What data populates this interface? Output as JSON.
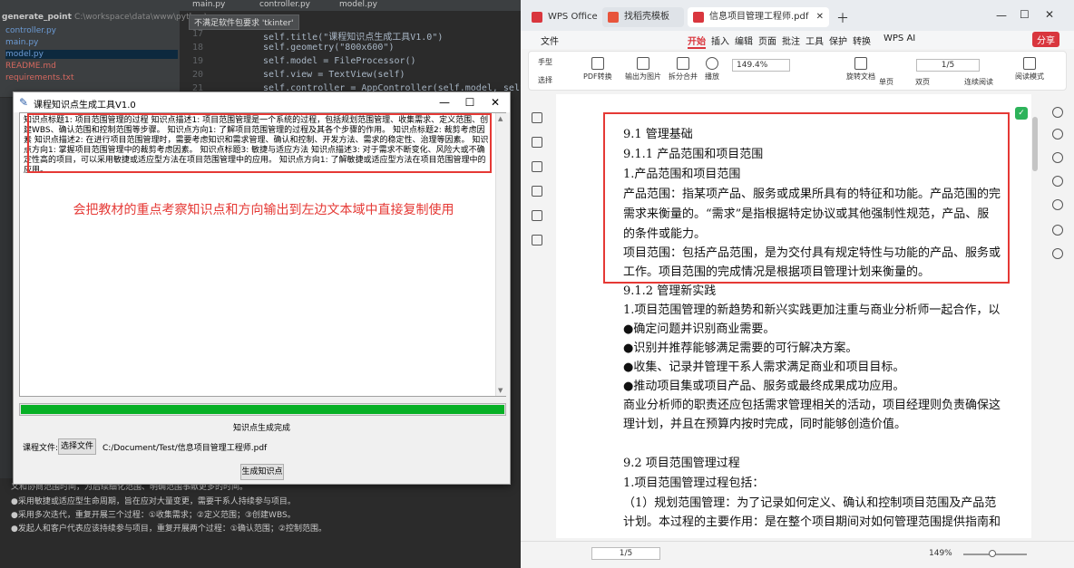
{
  "ide": {
    "tabs": [
      "main.py",
      "controller.py",
      "model.py"
    ],
    "project_root": "generate_point",
    "project_path": "C:\\workspace\\data\\www\\python\\e",
    "files": [
      "controller.py",
      "main.py",
      "model.py",
      "README.md",
      "requirements.txt"
    ],
    "tooltip": "不满足软件包要求 'tkinter'",
    "line_numbers": [
      "17",
      "18",
      "19",
      "20",
      "21"
    ],
    "code_lines": [
      "self.title(\"课程知识点生成工具V1.0\")",
      "self.geometry(\"800x600\")",
      "self.model = FileProcessor()",
      "self.view = TextView(self)",
      "self.controller = AppController(self.model, self.vie"
    ],
    "bottom_lines": [
      "义和协商范围时间，为后续细化范围、明确范围事献更多的时间。",
      "●采用敏捷或适应型生命周期，旨在应对大量变更，需要干系人持续参与项目。",
      "●采用多次迭代，重复开展三个过程：①收集需求；②定义范围；③创建WBS。",
      "●发起人和客户代表应该持续参与项目，重复开展两个过程：①确认范围；②控制范围。"
    ]
  },
  "tk": {
    "title": "课程知识点生成工具V1.0",
    "text_content": "知识点标题1: 项目范围管理的过程 知识点描述1: 项目范围管理是一个系统的过程，包括规划范围管理、收集需求、定义范围、创建WBS、确认范围和控制范围等步骤。 知识点方向1: 了解项目范围管理的过程及其各个步骤的作用。 知识点标题2: 裁剪考虑因素 知识点描述2: 在进行项目范围管理时，需要考虑知识和需求管理、确认和控制、开发方法、需求的稳定性、治理等因素。 知识点方向1: 掌握项目范围管理中的裁剪考虑因素。 知识点标题3: 敏捷与适应方法 知识点描述3: 对于需求不断变化、风险大或不确定性高的项目，可以采用敏捷或适应型方法在项目范围管理中的应用。 知识点方向1: 了解敏捷或适应型方法在项目范围管理中的应用。",
    "note": "会把教材的重点考察知识点和方向输出到左边文本域中直接复制使用",
    "progress": 1.0,
    "status": "知识点生成完成",
    "file_label": "课程文件:",
    "choose_button": "选择文件",
    "file_path": "C:/Document/Test/信息项目管理工程师.pdf",
    "generate_button": "生成知识点"
  },
  "wps": {
    "tabs": [
      "WPS Office",
      "找稻壳模板",
      "信息项目管理工程师.pdf"
    ],
    "menu": [
      "文件",
      "开始",
      "插入",
      "编辑",
      "页面",
      "批注",
      "工具",
      "保护",
      "转换",
      "WPS AI",
      "分享"
    ],
    "ribbon": [
      "手型",
      "选择",
      "PDF转换",
      "输出为图片",
      "拆分合并",
      "播放",
      "旋转文档",
      "单页",
      "双页",
      "连续阅读",
      "阅读模式"
    ],
    "zoom": "149.4%",
    "page": "1/5",
    "doc_lines": [
      "9.1 管理基础",
      "9.1.1 产品范围和项目范围",
      "1.产品范围和项目范围",
      "产品范围：指某项产品、服务或成果所具有的特征和功能。产品范围的完",
      "需求来衡量的。“需求”是指根据特定协议或其他强制性规范，产品、服",
      "的条件或能力。",
      "项目范围：包括产品范围，是为交付具有规定特性与功能的产品、服务或",
      "工作。项目范围的完成情况是根据项目管理计划来衡量的。",
      "9.1.2 管理新实践",
      "1.项目范围管理的新趋势和新兴实践更加注重与商业分析师一起合作，以",
      "●确定问题并识别商业需要。",
      "●识别并推荐能够满足需要的可行解决方案。",
      "●收集、记录并管理干系人需求满足商业和项目目标。",
      "●推动项目集或项目产品、服务或最终成果成功应用。",
      "商业分析师的职责还应包括需求管理相关的活动，项目经理则负责确保这",
      "理计划，并且在预算内按时完成，同时能够创造价值。",
      "9.2 项目范围管理过程",
      "1.项目范围管理过程包括：",
      "（1）规划范围管理：为了记录如何定义、确认和控制项目范围及产品范",
      "计划。本过程的主要作用：是在整个项目期间对如何管理范围提供指南和"
    ],
    "status_page": "1/5",
    "status_zoom": "149%",
    "zoom_level": 0.45,
    "accent": "#d9363e",
    "highlight": "#e53935"
  }
}
